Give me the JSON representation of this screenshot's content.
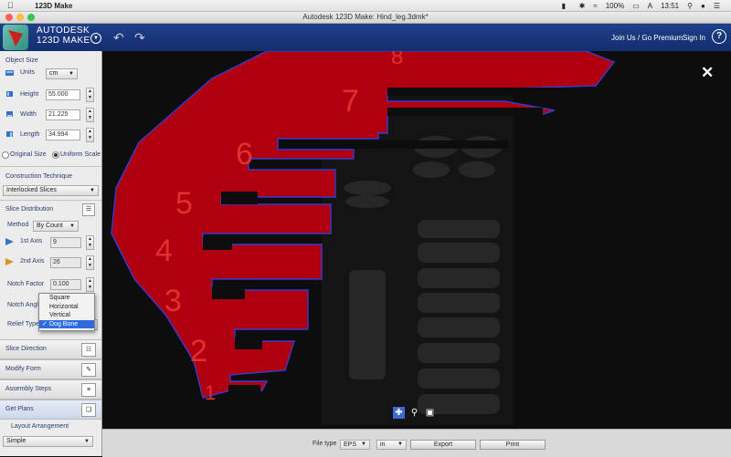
{
  "menubar": {
    "app_name": "123D Make",
    "status": "100%",
    "input_source": "A",
    "clock": "13:51"
  },
  "window": {
    "title": "Autodesk 123D Make: Hind_leg.3dmk*"
  },
  "header": {
    "brand_line1": "AUTODESK",
    "brand_line2": "123D MAKE",
    "join_label": "Join Us / Go Premium",
    "signin_label": "Sign In",
    "help_label": "?"
  },
  "panel": {
    "object_size": {
      "title": "Object Size",
      "units_label": "Units",
      "units_value": "cm",
      "height_label": "Height",
      "height_value": "55.000",
      "width_label": "Width",
      "width_value": "21.225",
      "length_label": "Length",
      "length_value": "34.994",
      "original_size_label": "Original Size",
      "uniform_scale_label": "Uniform Scale"
    },
    "construction": {
      "title": "Construction Technique",
      "value": "Interlocked Slices"
    },
    "distribution": {
      "title": "Slice Distribution",
      "method_label": "Method",
      "method_value": "By Count",
      "axis1_label": "1st Axis",
      "axis1_value": "9",
      "axis2_label": "2nd Axis",
      "axis2_value": "26",
      "notch_factor_label": "Notch Factor",
      "notch_factor_value": "0.100",
      "notch_angle_label": "Notch Angle",
      "relief_type_label": "Relief Type"
    },
    "relief_menu": {
      "options": [
        "Square",
        "Horizontal",
        "Vertical",
        "Dog Bone"
      ],
      "selected": "Dog Bone"
    },
    "sections": {
      "slice_direction": "Slice Direction",
      "modify_form": "Modify Form",
      "assembly_steps": "Assembly Steps",
      "get_plans": "Get Plans"
    },
    "layout": {
      "title": "Layout Arrangement",
      "value": "Simple"
    }
  },
  "canvas": {
    "slice_numbers": [
      "8",
      "7",
      "6",
      "5",
      "4",
      "3",
      "2",
      "1"
    ],
    "close_label": "✕"
  },
  "bottom": {
    "file_type_label": "File type",
    "file_type_value": "EPS",
    "unit_value": "in",
    "export_label": "Export",
    "print_label": "Print"
  },
  "colors": {
    "header_blue": "#1a3878",
    "slice_red": "#b0000f",
    "slice_outline": "#3a3ad0",
    "highlight_blue": "#2e6be0"
  }
}
